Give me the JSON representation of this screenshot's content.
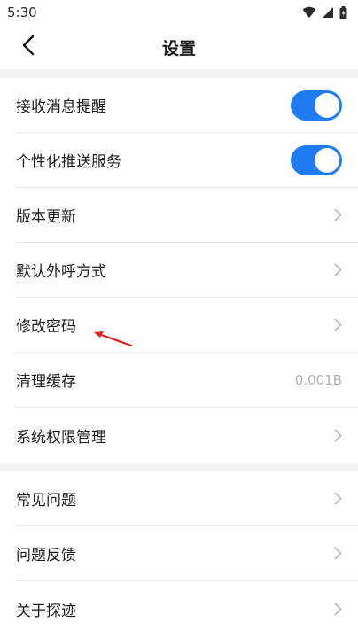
{
  "status": {
    "time": "5:30",
    "icons": [
      "wifi-icon",
      "signal-icon",
      "battery-icon"
    ]
  },
  "header": {
    "title": "设置",
    "back_icon": "chevron-left-icon"
  },
  "settings": {
    "notify": {
      "label": "接收消息提醒",
      "toggle_on": true
    },
    "push": {
      "label": "个性化推送服务",
      "toggle_on": true
    },
    "version": {
      "label": "版本更新"
    },
    "dial": {
      "label": "默认外呼方式"
    },
    "password": {
      "label": "修改密码"
    },
    "cache": {
      "label": "清理缓存",
      "value": "0.001B"
    },
    "permissions": {
      "label": "系统权限管理"
    }
  },
  "support": {
    "faq": {
      "label": "常见问题"
    },
    "feedback": {
      "label": "问题反馈"
    },
    "about": {
      "label": "关于探迹"
    }
  },
  "colors": {
    "accent": "#1f7cf2",
    "annotation": "#e02020",
    "divider": "#ececec",
    "section_gap": "#f2f3f5"
  }
}
